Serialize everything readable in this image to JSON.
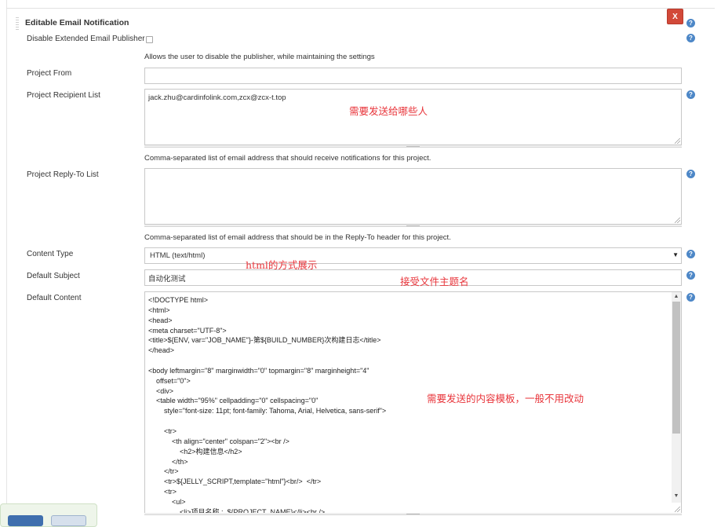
{
  "section": {
    "title": "Editable Email Notification",
    "close_label": "X"
  },
  "help_icon_glyph": "?",
  "disable_publisher": {
    "label": "Disable Extended Email Publisher",
    "checked": false,
    "description": "Allows the user to disable the publisher, while maintaining the settings"
  },
  "project_from": {
    "label": "Project From",
    "value": ""
  },
  "recipient_list": {
    "label": "Project Recipient List",
    "value": "jack.zhu@cardinfolink.com,zcx@zcx-t.top",
    "description": "Comma-separated list of email address that should receive notifications for this project."
  },
  "reply_to_list": {
    "label": "Project Reply-To List",
    "value": "",
    "description": "Comma-separated list of email address that should be in the Reply-To header for this project."
  },
  "content_type": {
    "label": "Content Type",
    "selected": "HTML (text/html)",
    "arrow": "▼"
  },
  "default_subject": {
    "label": "Default Subject",
    "value": "自动化测试"
  },
  "default_content": {
    "label": "Default Content",
    "lines": [
      "<!DOCTYPE html>",
      "<html>",
      "<head>",
      "<meta charset=\"UTF-8\">",
      "<title>${ENV, var=\"JOB_NAME\"}-第${BUILD_NUMBER}次构建日志</title>",
      "</head>",
      "",
      "<body leftmargin=\"8\" marginwidth=\"0\" topmargin=\"8\" marginheight=\"4\"",
      "    offset=\"0\">",
      "    <div>",
      "    <table width=\"95%\" cellpadding=\"0\" cellspacing=\"0\"",
      "        style=\"font-size: 11pt; font-family: Tahoma, Arial, Helvetica, sans-serif\">",
      "",
      "        <tr>",
      "            <th align=\"center\" colspan=\"2\"><br />",
      "                <h2>构建信息</h2>",
      "            </th>",
      "        </tr>",
      "        <tr>${JELLY_SCRIPT,template=\"html\"}<br/>  </tr>",
      "        <tr>",
      "            <ul>",
      "                <li>项目名称 :  ${PROJECT_NAME}</li><br />"
    ]
  },
  "annotations": {
    "recipients": "需要发送给哪些人",
    "content_type": "html的方式展示",
    "subject": "接受文件主题名",
    "content": "需要发送的内容模板，一般不用改动"
  },
  "colors": {
    "accent_red": "#e8343a",
    "help_blue": "#4d87c7",
    "close_red": "#d24939"
  }
}
